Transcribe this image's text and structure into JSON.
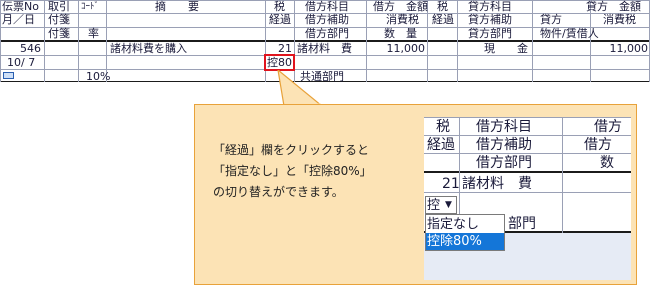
{
  "grid": {
    "headers": {
      "slip_no": "伝票No",
      "month_day": "月／日",
      "torihiki": "取引",
      "fusen1": "付箋",
      "fusen2": "付箋",
      "code": "ｺｰﾄﾞ",
      "rate": "率",
      "tekiyo": "摘　　要",
      "zei": "税",
      "keika": "経過",
      "debit_account": "借方科目",
      "debit_sub": "借方補助",
      "debit_dept": "借方部門",
      "debit_amount": "借方　金額",
      "debit_tax": "消費税",
      "qty": "数　量",
      "zei2": "税",
      "keika2": "経過",
      "credit_account": "貸方科目",
      "credit_sub": "貸方補助",
      "credit_dept": "貸方部門",
      "credit_amount": "貸方　金額",
      "credit_tax_a": "貸方",
      "credit_tax_b": "消費税",
      "partner": "物件/賃借人"
    },
    "row": {
      "slip_no": "546",
      "date": "10/ 7",
      "rate": "10%",
      "tekiyo": "諸材料費を購入",
      "debit_code": "21",
      "debit_account": "諸材料　費",
      "deduction": "控80",
      "debit_dept": "共通部門",
      "debit_amount": "11,000",
      "credit_account": "現　　金",
      "credit_amount": "11,000"
    }
  },
  "callout": {
    "line1": "「経過」欄をクリックすると",
    "line2": "「指定なし」と「控除80%」",
    "line3": "の切り替えができます。"
  },
  "zoom": {
    "h_zei": "税",
    "h_keika": "経過",
    "h_account": "借方科目",
    "h_sub": "借方補助",
    "h_dept": "借方部門",
    "h_right1": "借方",
    "h_right2": "借方",
    "h_right3": "数",
    "code": "21",
    "account": "諸材料　費",
    "select_value": "控",
    "dept_partial": "部門",
    "options": [
      "指定なし",
      "控除80%"
    ]
  },
  "colors": {
    "highlight_red": "#e0141e",
    "callout_bg": "#fce3b5",
    "callout_border": "#e8a23a",
    "selected_option_bg": "#1476d8"
  }
}
